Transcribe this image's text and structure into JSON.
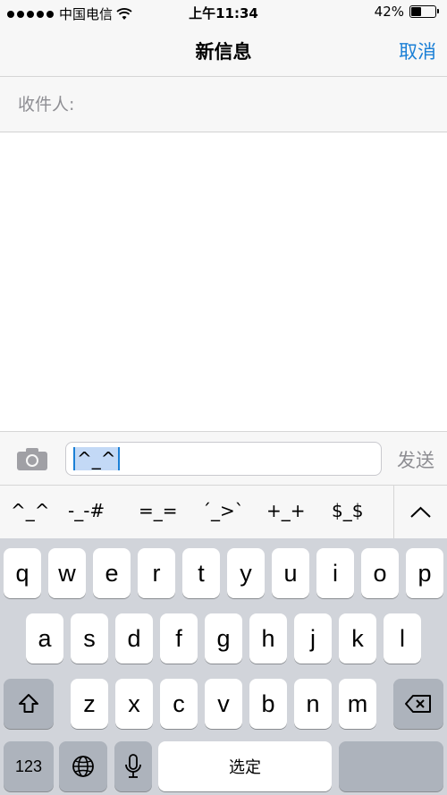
{
  "status": {
    "carrier": "中国电信",
    "time": "上午11:34",
    "battery_percent": "42%",
    "battery_level": 0.42
  },
  "nav": {
    "title": "新信息",
    "cancel_label": "取消"
  },
  "recipient": {
    "label": "收件人:"
  },
  "input": {
    "typed_text": "^_^",
    "send_label": "发送"
  },
  "candidates": [
    "^_^",
    "-_-#",
    "=_=",
    "´_>`",
    "+_+",
    "$_$"
  ],
  "keyboard": {
    "row1": [
      "q",
      "w",
      "e",
      "r",
      "t",
      "y",
      "u",
      "i",
      "o",
      "p"
    ],
    "row2": [
      "a",
      "s",
      "d",
      "f",
      "g",
      "h",
      "j",
      "k",
      "l"
    ],
    "row3": [
      "z",
      "x",
      "c",
      "v",
      "b",
      "n",
      "m"
    ],
    "numbers_label": "123",
    "space_label": "选定"
  },
  "icons": {
    "signal": "signal-dots-icon",
    "wifi": "wifi-icon",
    "battery": "battery-icon",
    "camera": "camera-icon",
    "chevron": "chevron-up-icon",
    "shift": "shift-icon",
    "delete": "delete-icon",
    "globe": "globe-icon",
    "mic": "microphone-icon"
  },
  "colors": {
    "accent": "#1a7fd6",
    "gray_text": "#8e8e93"
  }
}
